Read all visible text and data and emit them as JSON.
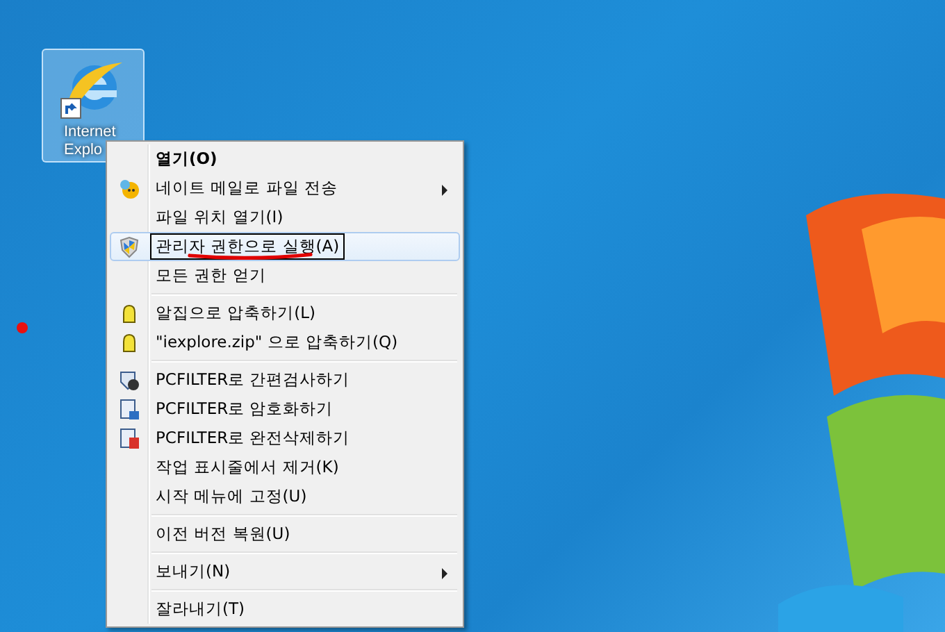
{
  "desktop_icon": {
    "label": "Internet Explo",
    "selected": true
  },
  "context_menu": {
    "items": [
      {
        "kind": "item",
        "label": "열기(O)",
        "default": true,
        "selected": false,
        "submenu": false
      },
      {
        "kind": "item",
        "label": "네이트 메일로 파일 전송",
        "selected": false,
        "submenu": true
      },
      {
        "kind": "item",
        "label": "파일 위치 열기(I)",
        "selected": false,
        "submenu": false
      },
      {
        "kind": "item",
        "label": "관리자 권한으로 실행(A)",
        "selected": true,
        "annotated": true,
        "submenu": false
      },
      {
        "kind": "item",
        "label": "모든 권한 얻기",
        "selected": false,
        "submenu": false
      },
      {
        "kind": "separator"
      },
      {
        "kind": "item",
        "label": "알집으로 압축하기(L)",
        "selected": false,
        "submenu": false
      },
      {
        "kind": "item",
        "label": "\"iexplore.zip\" 으로 압축하기(Q)",
        "selected": false,
        "submenu": false
      },
      {
        "kind": "separator"
      },
      {
        "kind": "item",
        "label": "PCFILTER로 간편검사하기",
        "selected": false,
        "submenu": false
      },
      {
        "kind": "item",
        "label": "PCFILTER로 암호화하기",
        "selected": false,
        "submenu": false
      },
      {
        "kind": "item",
        "label": "PCFILTER로 완전삭제하기",
        "selected": false,
        "submenu": false
      },
      {
        "kind": "item",
        "label": "작업 표시줄에서 제거(K)",
        "selected": false,
        "submenu": false
      },
      {
        "kind": "item",
        "label": "시작 메뉴에 고정(U)",
        "selected": false,
        "submenu": false
      },
      {
        "kind": "separator"
      },
      {
        "kind": "item",
        "label": "이전 버전 복원(U)",
        "selected": false,
        "submenu": false
      },
      {
        "kind": "separator"
      },
      {
        "kind": "item",
        "label": "보내기(N)",
        "selected": false,
        "submenu": true
      },
      {
        "kind": "separator"
      },
      {
        "kind": "item",
        "label": "잘라내기(T)",
        "selected": false,
        "submenu": false
      }
    ]
  }
}
